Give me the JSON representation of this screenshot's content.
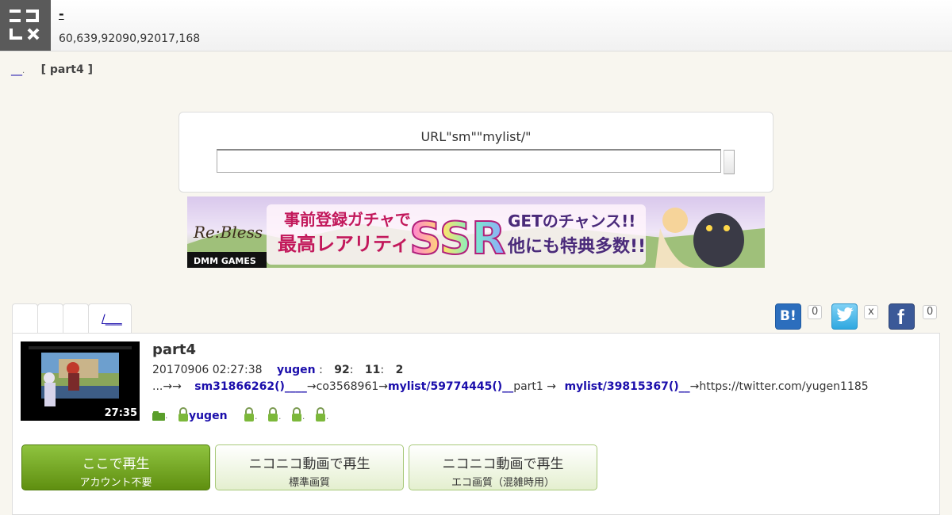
{
  "header": {
    "logo_text": "ニコメ",
    "title": " - ",
    "stats": "60,639,92090,92017,168"
  },
  "breadcrumb": {
    "home_link": "__",
    "separator": ".",
    "current": "[ part4 ]"
  },
  "search": {
    "label": "URL\"sm\"\"mylist/\"",
    "value": "",
    "button_label": ""
  },
  "banner": {
    "brand": "Re:Bless",
    "publisher": "DMM GAMES",
    "line1": "事前登録ガチャで",
    "line2": "最高レアリティ",
    "highlight": "SSR",
    "line3": "GETのチャンス!!",
    "line4": "他にも特典多数!!"
  },
  "tabs": {
    "items": [
      "",
      "",
      "",
      "/___"
    ]
  },
  "share": {
    "hatena_label": "B!",
    "hatena_count": "0",
    "twitter_count": "x",
    "facebook_label": "f",
    "facebook_count": "0"
  },
  "video": {
    "title": "part4",
    "duration": "27:35",
    "posted_at": "20170906 02:27:38",
    "author": "yugen",
    "sep1": ":",
    "views": "92",
    "sep2": ":",
    "comments": "11",
    "sep3": ":",
    "mylists": "2",
    "desc_prefix": "...→→",
    "desc_link1": "sm31866262()____",
    "desc_mid1": "→co3568961→",
    "desc_link2": "mylist/59774445()__",
    "desc_mid2": "part1 →",
    "desc_link3": "mylist/39815367()__",
    "desc_suffix": "→https://twitter.com/yugen1185",
    "tags": [
      {
        "icon": "folder",
        "label": "",
        "link": false
      },
      {
        "icon": "lock",
        "label": "yugen",
        "link": true
      },
      {
        "icon": "lock",
        "label": "",
        "link": false
      },
      {
        "icon": "lock",
        "label": "",
        "link": false
      },
      {
        "icon": "lock",
        "label": "",
        "link": false
      },
      {
        "icon": "lock",
        "label": "",
        "link": false
      }
    ],
    "tag_dot": "."
  },
  "play_buttons": [
    {
      "main": "ここで再生",
      "sub": "アカウント不要"
    },
    {
      "main": "ニコニコ動画で再生",
      "sub": "標準画質"
    },
    {
      "main": "ニコニコ動画で再生",
      "sub": "エコ画質（混雑時用）"
    }
  ],
  "colors": {
    "accent_green": "#6ea51f",
    "link": "#1a0dab",
    "background": "#f8f6ef"
  }
}
